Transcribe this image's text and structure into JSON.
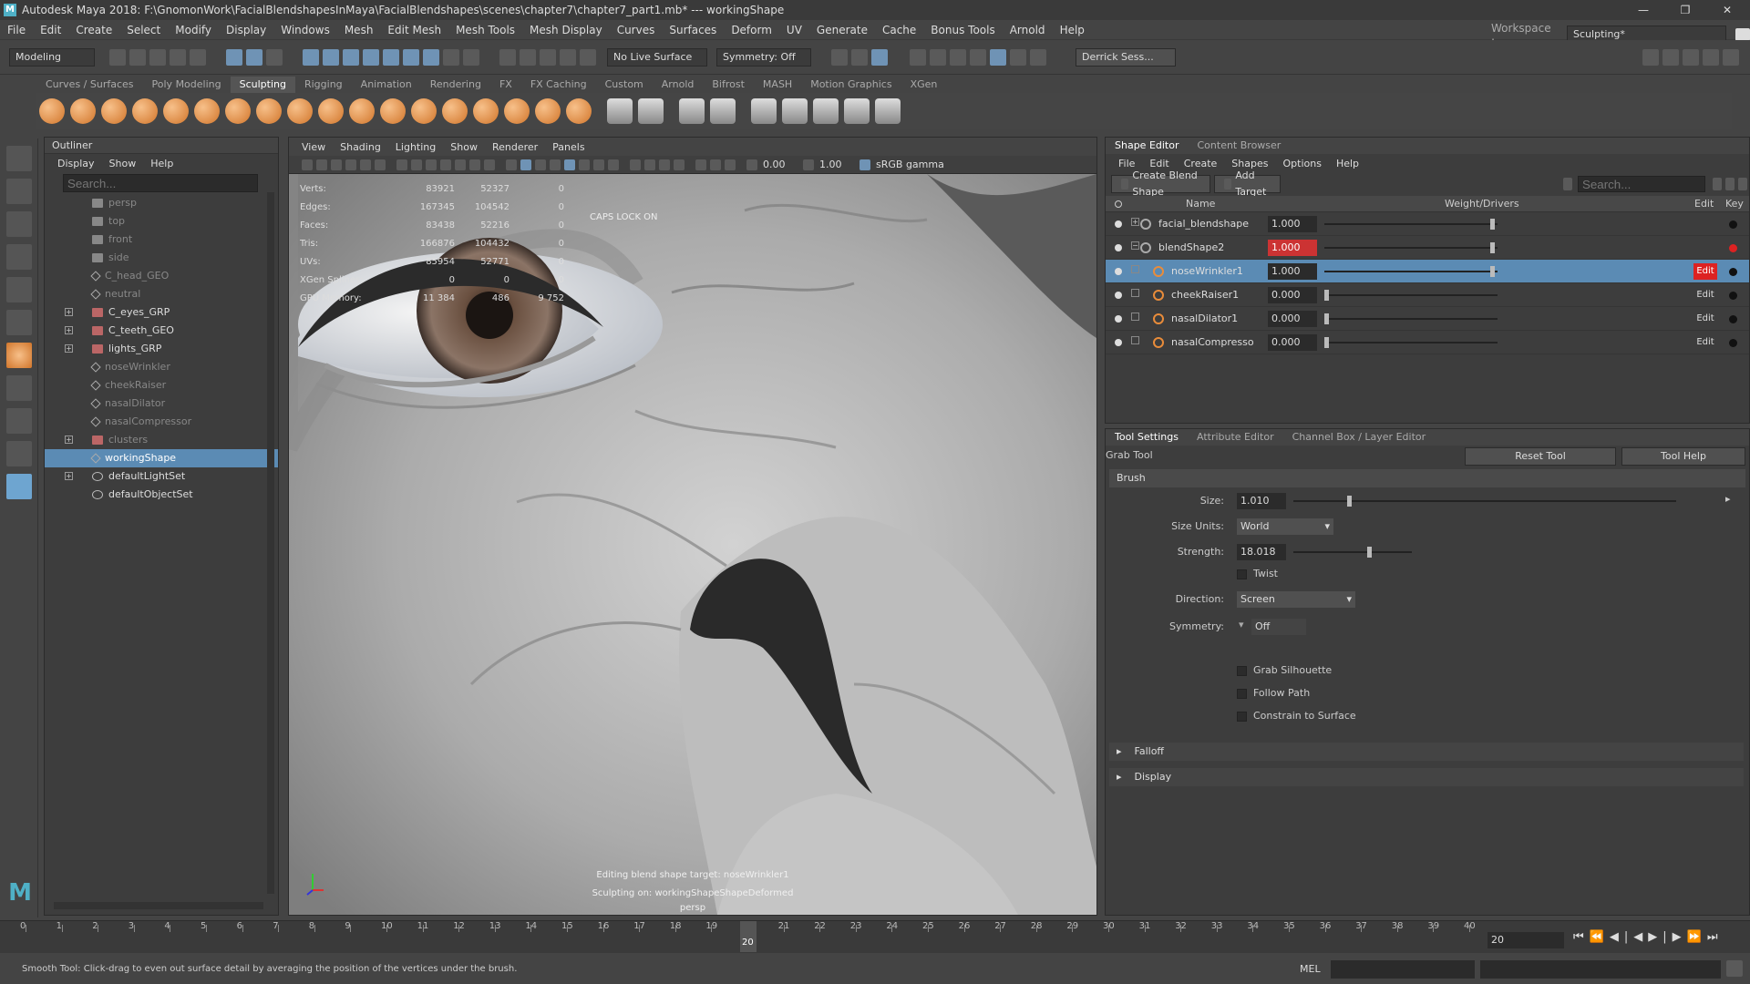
{
  "title_bar": {
    "text": "Autodesk Maya 2018: F:\\GnomonWork\\FacialBlendshapesInMaya\\FacialBlendshapes\\scenes\\chapter7\\chapter7_part1.mb*   ---   workingShape",
    "workspace_label": "Workspace :",
    "workspace_value": "Sculpting*"
  },
  "menubar": [
    "File",
    "Edit",
    "Create",
    "Select",
    "Modify",
    "Display",
    "Windows",
    "Mesh",
    "Edit Mesh",
    "Mesh Tools",
    "Mesh Display",
    "Curves",
    "Surfaces",
    "Deform",
    "UV",
    "Generate",
    "Cache",
    "Bonus Tools",
    "Arnold",
    "Help"
  ],
  "status_line": {
    "menu_set": "Modeling",
    "live_surface": "No Live Surface",
    "symmetry": "Symmetry: Off",
    "user": "Derrick Sess..."
  },
  "shelf_tabs": [
    "Curves / Surfaces",
    "Poly Modeling",
    "Sculpting",
    "Rigging",
    "Animation",
    "Rendering",
    "FX",
    "FX Caching",
    "Custom",
    "Arnold",
    "Bifrost",
    "MASH",
    "Motion Graphics",
    "XGen"
  ],
  "shelf_active": "Sculpting",
  "outliner": {
    "tab": "Outliner",
    "menu": [
      "Display",
      "Show",
      "Help"
    ],
    "search_placeholder": "Search...",
    "items": [
      {
        "label": "persp",
        "icon": "camera",
        "lit": false,
        "expand": false
      },
      {
        "label": "top",
        "icon": "camera",
        "lit": false,
        "expand": false
      },
      {
        "label": "front",
        "icon": "camera",
        "lit": false,
        "expand": false
      },
      {
        "label": "side",
        "icon": "camera",
        "lit": false,
        "expand": false
      },
      {
        "label": "C_head_GEO",
        "icon": "shape",
        "lit": false,
        "expand": false
      },
      {
        "label": "neutral",
        "icon": "shape",
        "lit": false,
        "expand": false
      },
      {
        "label": "C_eyes_GRP",
        "icon": "group",
        "lit": true,
        "expand": true
      },
      {
        "label": "C_teeth_GEO",
        "icon": "group",
        "lit": true,
        "expand": true
      },
      {
        "label": "lights_GRP",
        "icon": "group",
        "lit": true,
        "expand": true
      },
      {
        "label": "noseWrinkler",
        "icon": "shape",
        "lit": false,
        "expand": false
      },
      {
        "label": "cheekRaiser",
        "icon": "shape",
        "lit": false,
        "expand": false
      },
      {
        "label": "nasalDilator",
        "icon": "shape",
        "lit": false,
        "expand": false
      },
      {
        "label": "nasalCompressor",
        "icon": "shape",
        "lit": false,
        "expand": false
      },
      {
        "label": "clusters",
        "icon": "group",
        "lit": false,
        "expand": true
      },
      {
        "label": "workingShape",
        "icon": "shape",
        "lit": true,
        "expand": false,
        "selected": true
      },
      {
        "label": "defaultLightSet",
        "icon": "set",
        "lit": true,
        "expand": true
      },
      {
        "label": "defaultObjectSet",
        "icon": "set",
        "lit": true,
        "expand": false
      }
    ]
  },
  "viewport": {
    "menu": [
      "View",
      "Shading",
      "Lighting",
      "Show",
      "Renderer",
      "Panels"
    ],
    "field1": "0.00",
    "field2": "1.00",
    "color_space": "sRGB gamma",
    "hud": [
      {
        "label": "Verts:",
        "a": "83921",
        "b": "52327",
        "c": "0"
      },
      {
        "label": "Edges:",
        "a": "167345",
        "b": "104542",
        "c": "0"
      },
      {
        "label": "Faces:",
        "a": "83438",
        "b": "52216",
        "c": "0"
      },
      {
        "label": "Tris:",
        "a": "166876",
        "b": "104432",
        "c": "0"
      },
      {
        "label": "UVs:",
        "a": "85954",
        "b": "52771",
        "c": "0"
      },
      {
        "label": "XGen Splines:",
        "a": "0",
        "b": "0",
        "c": "0"
      },
      {
        "label": "GPU Memory:",
        "a": "11 384",
        "b": "486",
        "c": "9 752"
      }
    ],
    "caps_lock": "CAPS LOCK ON",
    "footer_1": "Editing blend shape target: noseWrinkler1",
    "footer_2": "Sculpting on: workingShapeShapeDeformed",
    "camera": "persp"
  },
  "shape_editor": {
    "tabs": [
      "Shape Editor",
      "Content Browser"
    ],
    "menu": [
      "File",
      "Edit",
      "Create",
      "Shapes",
      "Options",
      "Help"
    ],
    "create_button": "Create Blend Shape",
    "add_target_button": "Add Target",
    "search_placeholder": "Search...",
    "columns": {
      "name": "Name",
      "weight": "Weight/Drivers",
      "edit": "Edit",
      "key": "Key"
    },
    "rows": [
      {
        "name": "facial_blendshape",
        "weight": "1.000",
        "weight_fraction": 1.0,
        "level": 0,
        "red": false,
        "selected": false,
        "edit": "",
        "key_red": false
      },
      {
        "name": "blendShape2",
        "weight": "1.000",
        "weight_fraction": 1.0,
        "level": 0,
        "red": true,
        "selected": false,
        "edit": "",
        "key_red": true
      },
      {
        "name": "noseWrinkler1",
        "weight": "1.000",
        "weight_fraction": 1.0,
        "level": 1,
        "red": false,
        "selected": true,
        "edit": "Edit",
        "edit_red": true,
        "key_red": false
      },
      {
        "name": "cheekRaiser1",
        "weight": "0.000",
        "weight_fraction": 0.0,
        "level": 1,
        "red": false,
        "selected": false,
        "edit": "Edit",
        "key_red": false
      },
      {
        "name": "nasalDilator1",
        "weight": "0.000",
        "weight_fraction": 0.0,
        "level": 1,
        "red": false,
        "selected": false,
        "edit": "Edit",
        "key_red": false
      },
      {
        "name": "nasalCompresso",
        "weight": "0.000",
        "weight_fraction": 0.0,
        "level": 1,
        "red": false,
        "selected": false,
        "edit": "Edit",
        "key_red": false
      }
    ]
  },
  "tool_settings": {
    "tabs": [
      "Tool Settings",
      "Attribute Editor",
      "Channel Box / Layer Editor"
    ],
    "tool_name": "Grab Tool",
    "reset_button": "Reset Tool",
    "help_button": "Tool Help",
    "brush_section": "Brush",
    "size_label": "Size:",
    "size_value": "1.010",
    "size_fraction": 0.14,
    "size_units_label": "Size Units:",
    "size_units_value": "World",
    "strength_label": "Strength:",
    "strength_value": "18.018",
    "strength_fraction": 0.62,
    "twist_label": "Twist",
    "direction_label": "Direction:",
    "direction_value": "Screen",
    "symmetry_label": "Symmetry:",
    "symmetry_value": "Off",
    "grab_silhouette": "Grab Silhouette",
    "follow_path": "Follow Path",
    "constrain_surface": "Constrain to Surface",
    "falloff_section": "Falloff",
    "display_section": "Display"
  },
  "timeline": {
    "ticks": [
      "0",
      "1",
      "2",
      "3",
      "4",
      "5",
      "6",
      "7",
      "8",
      "9",
      "10",
      "11",
      "12",
      "13",
      "14",
      "15",
      "16",
      "17",
      "18",
      "19",
      "20",
      "21",
      "22",
      "23",
      "24",
      "25",
      "26",
      "27",
      "28",
      "29",
      "30",
      "31",
      "32",
      "33",
      "34",
      "35",
      "36",
      "37",
      "38",
      "39",
      "40"
    ],
    "current": "20",
    "current_field": "20"
  },
  "command_line": {
    "help": "Smooth Tool: Click-drag to even out surface detail by averaging the position of the vertices under the brush.",
    "lang": "MEL"
  },
  "colors": {
    "selection": "#5b8bb4",
    "key_red": "#dd2222",
    "accent_orange": "#e98c3a"
  }
}
